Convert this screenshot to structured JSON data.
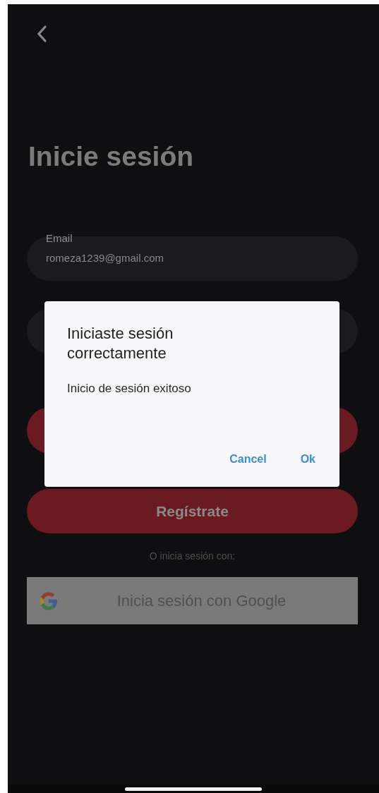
{
  "title": "Inicie sesión",
  "email_field": {
    "label": "Email",
    "value": "romeza1239@gmail.com"
  },
  "register_button": {
    "label": "Regístrate"
  },
  "alt_login_text": "O inicia sesión con:",
  "google_button": {
    "label": "Inicia sesión con Google"
  },
  "dialog": {
    "title": "Iniciaste sesión correctamente",
    "message": "Inicio de sesión exitoso",
    "buttons": [
      "Cancel",
      "Ok"
    ]
  }
}
